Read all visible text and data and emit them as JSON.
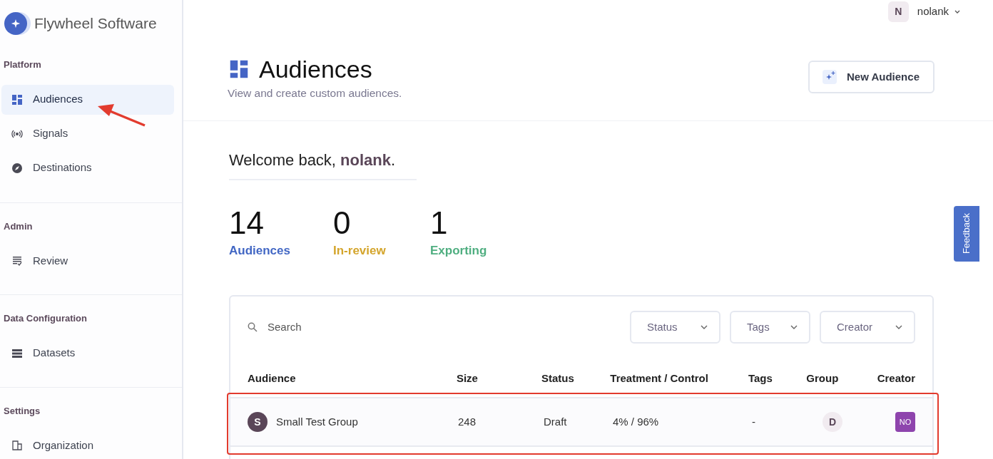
{
  "brand": {
    "name": "Flywheel Software"
  },
  "sidebar": {
    "sections": [
      {
        "title": "Platform",
        "items": [
          {
            "label": "Audiences",
            "selected": true
          },
          {
            "label": "Signals",
            "selected": false
          },
          {
            "label": "Destinations",
            "selected": false
          }
        ]
      },
      {
        "title": "Admin",
        "items": [
          {
            "label": "Review",
            "selected": false
          }
        ]
      },
      {
        "title": "Data Configuration",
        "items": [
          {
            "label": "Datasets",
            "selected": false
          }
        ]
      },
      {
        "title": "Settings",
        "items": [
          {
            "label": "Organization",
            "selected": false
          }
        ]
      }
    ]
  },
  "user_menu": {
    "initial": "N",
    "name": "nolank"
  },
  "header": {
    "title": "Audiences",
    "subtitle": "View and create custom audiences.",
    "button": "New Audience"
  },
  "welcome": {
    "text": "Welcome back, **nolank**."
  },
  "stats": [
    {
      "value": "14",
      "label": "Audiences",
      "color": "#4267c4"
    },
    {
      "value": "0",
      "label": "In-review",
      "color": "#d4a52c"
    },
    {
      "value": "1",
      "label": "Exporting",
      "color": "#4fae80"
    }
  ],
  "feedback": "Feedback",
  "table": {
    "search": {
      "placeholder": "Search"
    },
    "filters": [
      "Status",
      "Tags",
      "Creator"
    ],
    "columns": [
      "Audience",
      "Size",
      "Status",
      "Treatment / Control",
      "Tags",
      "Group",
      "Creator"
    ],
    "rows": [
      {
        "initial": "S",
        "name": "Small Test Group",
        "size": "248",
        "status": "Draft",
        "split": "4% / 96%",
        "tags": "-",
        "group": "D",
        "creator": "NO"
      }
    ]
  }
}
